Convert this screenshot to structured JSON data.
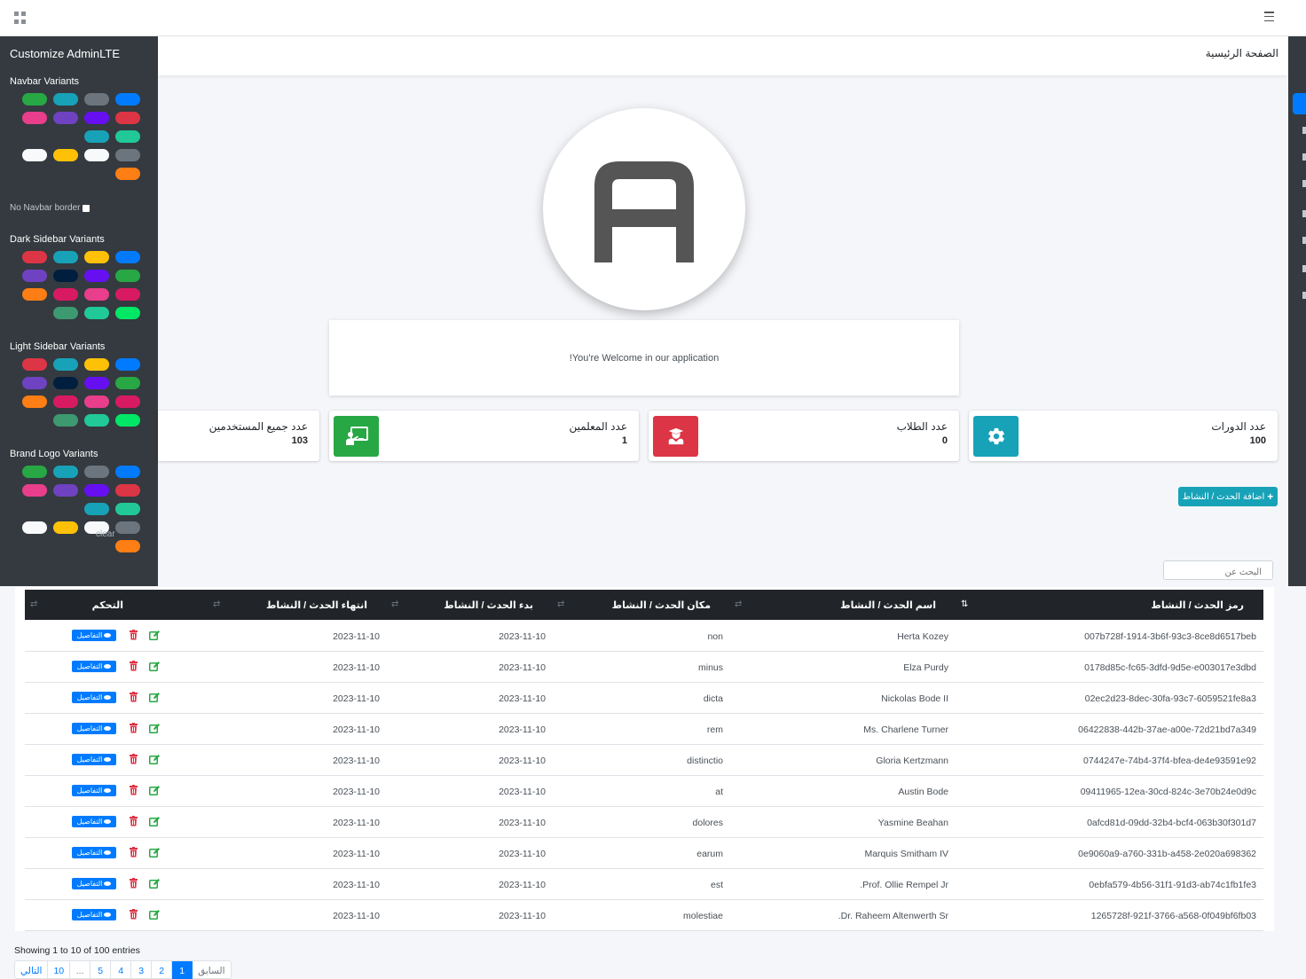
{
  "navbar": {
    "left_icon": "grid-icon",
    "right_icon": "bars-icon"
  },
  "control_sidebar": {
    "title": "Customize AdminLTE",
    "navbar_variants_title": "Navbar Variants",
    "navbar_variants": [
      "#007bff",
      "#6c757d",
      "#17a2b8",
      "#28a745",
      "#dc3545",
      "#6610f2",
      "#6f42c1",
      "#e83e8c",
      "#20c997",
      "#17a2b8",
      "#343a40",
      "#343a40",
      "#6c757d",
      "#f8f9fa",
      "#ffc107",
      "#f8f9fa",
      "#fd7e14"
    ],
    "no_navbar_border_label": "No Navbar border",
    "dark_sidebar_title": "Dark Sidebar Variants",
    "dark_sidebar_variants": [
      "#007bff",
      "#ffc107",
      "#17a2b8",
      "#dc3545",
      "#28a745",
      "#6610f2",
      "#001f3f",
      "#6f42c1",
      "#d81b60",
      "#e83e8c",
      "#d81b60",
      "#fd7e14",
      "#00e765",
      "#20c997",
      "#3d9970"
    ],
    "light_sidebar_title": "Light Sidebar Variants",
    "light_sidebar_variants": [
      "#007bff",
      "#ffc107",
      "#17a2b8",
      "#dc3545",
      "#28a745",
      "#6610f2",
      "#001f3f",
      "#6f42c1",
      "#d81b60",
      "#e83e8c",
      "#d81b60",
      "#fd7e14",
      "#00e765",
      "#20c997",
      "#3d9970"
    ],
    "brand_logo_title": "Brand Logo Variants",
    "brand_logo_variants": [
      "#007bff",
      "#6c757d",
      "#17a2b8",
      "#28a745",
      "#dc3545",
      "#6610f2",
      "#6f42c1",
      "#e83e8c",
      "#20c997",
      "#17a2b8",
      "#343a40",
      "#343a40",
      "#6c757d",
      "#f8f9fa",
      "#ffc107",
      "#f8f9fa",
      "#fd7e14"
    ],
    "clear_label": "clear"
  },
  "breadcrumb": "الصفحة الرئيسية",
  "welcome_text": "You're Welcome in our application!",
  "stats": [
    {
      "label": "عدد الدورات",
      "value": "100",
      "icon": "gear-icon",
      "color": "#17a2b8"
    },
    {
      "label": "عدد الطلاب",
      "value": "0",
      "icon": "user-graduate-icon",
      "color": "#dc3545"
    },
    {
      "label": "عدد المعلمين",
      "value": "1",
      "icon": "chalkboard-teacher-icon",
      "color": "#28a745"
    },
    {
      "label": "عدد جميع المستخدمين",
      "value": "103",
      "icon": "",
      "color": ""
    }
  ],
  "add_button_label": "اضافة الحدث / النشاط",
  "search_placeholder": "البحث عن",
  "table": {
    "columns": [
      "رمز الحدث / النشاط",
      "اسم الحدث / النشاط",
      "مكان الحدث / النشاط",
      "بدء الحدث / النشاط",
      "انتهاء الحدث / النشاط",
      "التحكم"
    ],
    "details_label": "التفاصيل",
    "rows": [
      [
        "007b728f-1914-3b6f-93c3-8ce8d6517beb",
        "Herta Kozey",
        "non",
        "2023-11-10",
        "2023-11-10"
      ],
      [
        "0178d85c-fc65-3dfd-9d5e-e003017e3dbd",
        "Elza Purdy",
        "minus",
        "2023-11-10",
        "2023-11-10"
      ],
      [
        "02ec2d23-8dec-30fa-93c7-6059521fe8a3",
        "Nickolas Bode II",
        "dicta",
        "2023-11-10",
        "2023-11-10"
      ],
      [
        "06422838-442b-37ae-a00e-72d21bd7a349",
        "Ms. Charlene Turner",
        "rem",
        "2023-11-10",
        "2023-11-10"
      ],
      [
        "0744247e-74b4-37f4-bfea-de4e93591e92",
        "Gloria Kertzmann",
        "distinctio",
        "2023-11-10",
        "2023-11-10"
      ],
      [
        "09411965-12ea-30cd-824c-3e70b24e0d9c",
        "Austin Bode",
        "at",
        "2023-11-10",
        "2023-11-10"
      ],
      [
        "0afcd81d-09dd-32b4-bcf4-063b30f301d7",
        "Yasmine Beahan",
        "dolores",
        "2023-11-10",
        "2023-11-10"
      ],
      [
        "0e9060a9-a760-331b-a458-2e020a698362",
        "Marquis Smitham IV",
        "earum",
        "2023-11-10",
        "2023-11-10"
      ],
      [
        "0ebfa579-4b56-31f1-91d3-ab74c1fb1fe3",
        "Prof. Ollie Rempel Jr.",
        "est",
        "2023-11-10",
        "2023-11-10"
      ],
      [
        "1265728f-921f-3766-a568-0f049bf6fb03",
        "Dr. Raheem Altenwerth Sr.",
        "molestiae",
        "2023-11-10",
        "2023-11-10"
      ]
    ]
  },
  "showing_text": "Showing 1 to 10 of 100 entries",
  "pagination": [
    "التالي",
    "10",
    "...",
    "5",
    "4",
    "3",
    "2",
    "1",
    "السابق"
  ],
  "pagination_active": "1"
}
